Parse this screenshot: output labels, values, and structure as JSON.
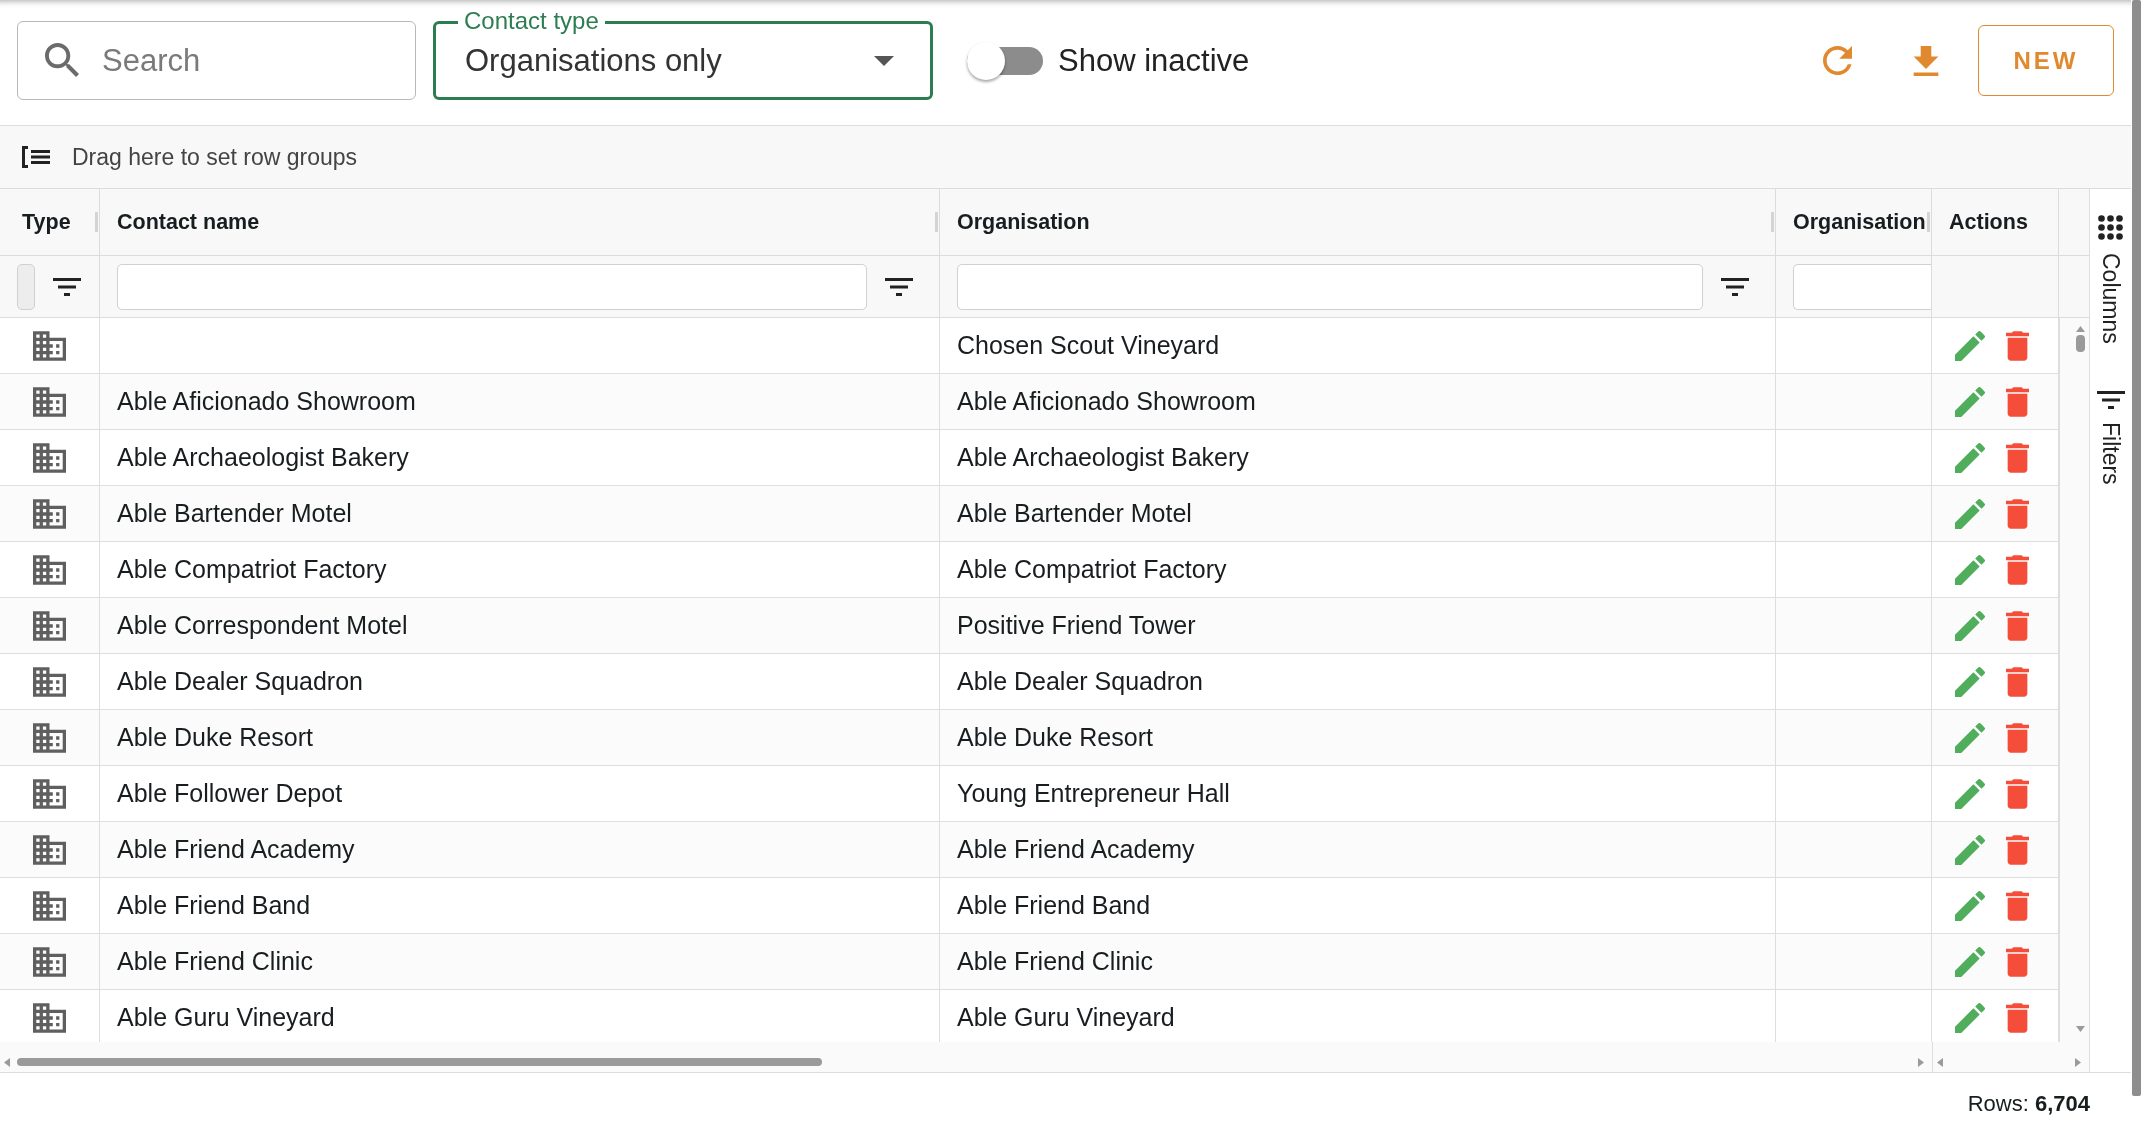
{
  "toolbar": {
    "search": {
      "placeholder": "Search"
    },
    "contact_type": {
      "label": "Contact type",
      "value": "Organisations only"
    },
    "show_inactive": {
      "label": "Show inactive",
      "on": false
    },
    "new_button": {
      "label": "NEW"
    }
  },
  "row_groups": {
    "hint": "Drag here to set row groups"
  },
  "table": {
    "columns": [
      {
        "label": "Type",
        "filter": true
      },
      {
        "label": "Contact name",
        "filter": true
      },
      {
        "label": "Organisation",
        "filter": true
      },
      {
        "label": "Organisation",
        "filter": true
      },
      {
        "label": "Actions",
        "filter": false
      }
    ],
    "rows": [
      {
        "kind": "organisation",
        "organisation": "Chosen Scout Vineyard"
      },
      {
        "kind": "organisation",
        "contact_name": "Able Aficionado Showroom",
        "organisation": "Able Aficionado Showroom"
      },
      {
        "kind": "organisation",
        "contact_name": "Able Archaeologist Bakery",
        "organisation": "Able Archaeologist Bakery"
      },
      {
        "kind": "organisation",
        "contact_name": "Able Bartender Motel",
        "organisation": "Able Bartender Motel"
      },
      {
        "kind": "organisation",
        "contact_name": "Able Compatriot Factory",
        "organisation": "Able Compatriot Factory"
      },
      {
        "kind": "organisation",
        "contact_name": "Able Correspondent Motel",
        "organisation": "Positive Friend Tower"
      },
      {
        "kind": "organisation",
        "contact_name": "Able Dealer Squadron",
        "organisation": "Able Dealer Squadron"
      },
      {
        "kind": "organisation",
        "contact_name": "Able Duke Resort",
        "organisation": "Able Duke Resort"
      },
      {
        "kind": "organisation",
        "contact_name": "Able Follower Depot",
        "organisation": "Young Entrepreneur Hall"
      },
      {
        "kind": "organisation",
        "contact_name": "Able Friend Academy",
        "organisation": "Able Friend Academy"
      },
      {
        "kind": "organisation",
        "contact_name": "Able Friend Band",
        "organisation": "Able Friend Band"
      },
      {
        "kind": "organisation",
        "contact_name": "Able Friend Clinic",
        "organisation": "Able Friend Clinic"
      },
      {
        "kind": "organisation",
        "contact_name": "Able Guru Vineyard",
        "organisation": "Able Guru Vineyard"
      }
    ]
  },
  "side_panel": {
    "tabs": [
      {
        "kind": "columns",
        "label": "Columns",
        "selected": false
      },
      {
        "kind": "filters",
        "label": "Filters",
        "selected": false
      }
    ]
  },
  "status_bar": {
    "text": "Rows: **6,704**"
  }
}
